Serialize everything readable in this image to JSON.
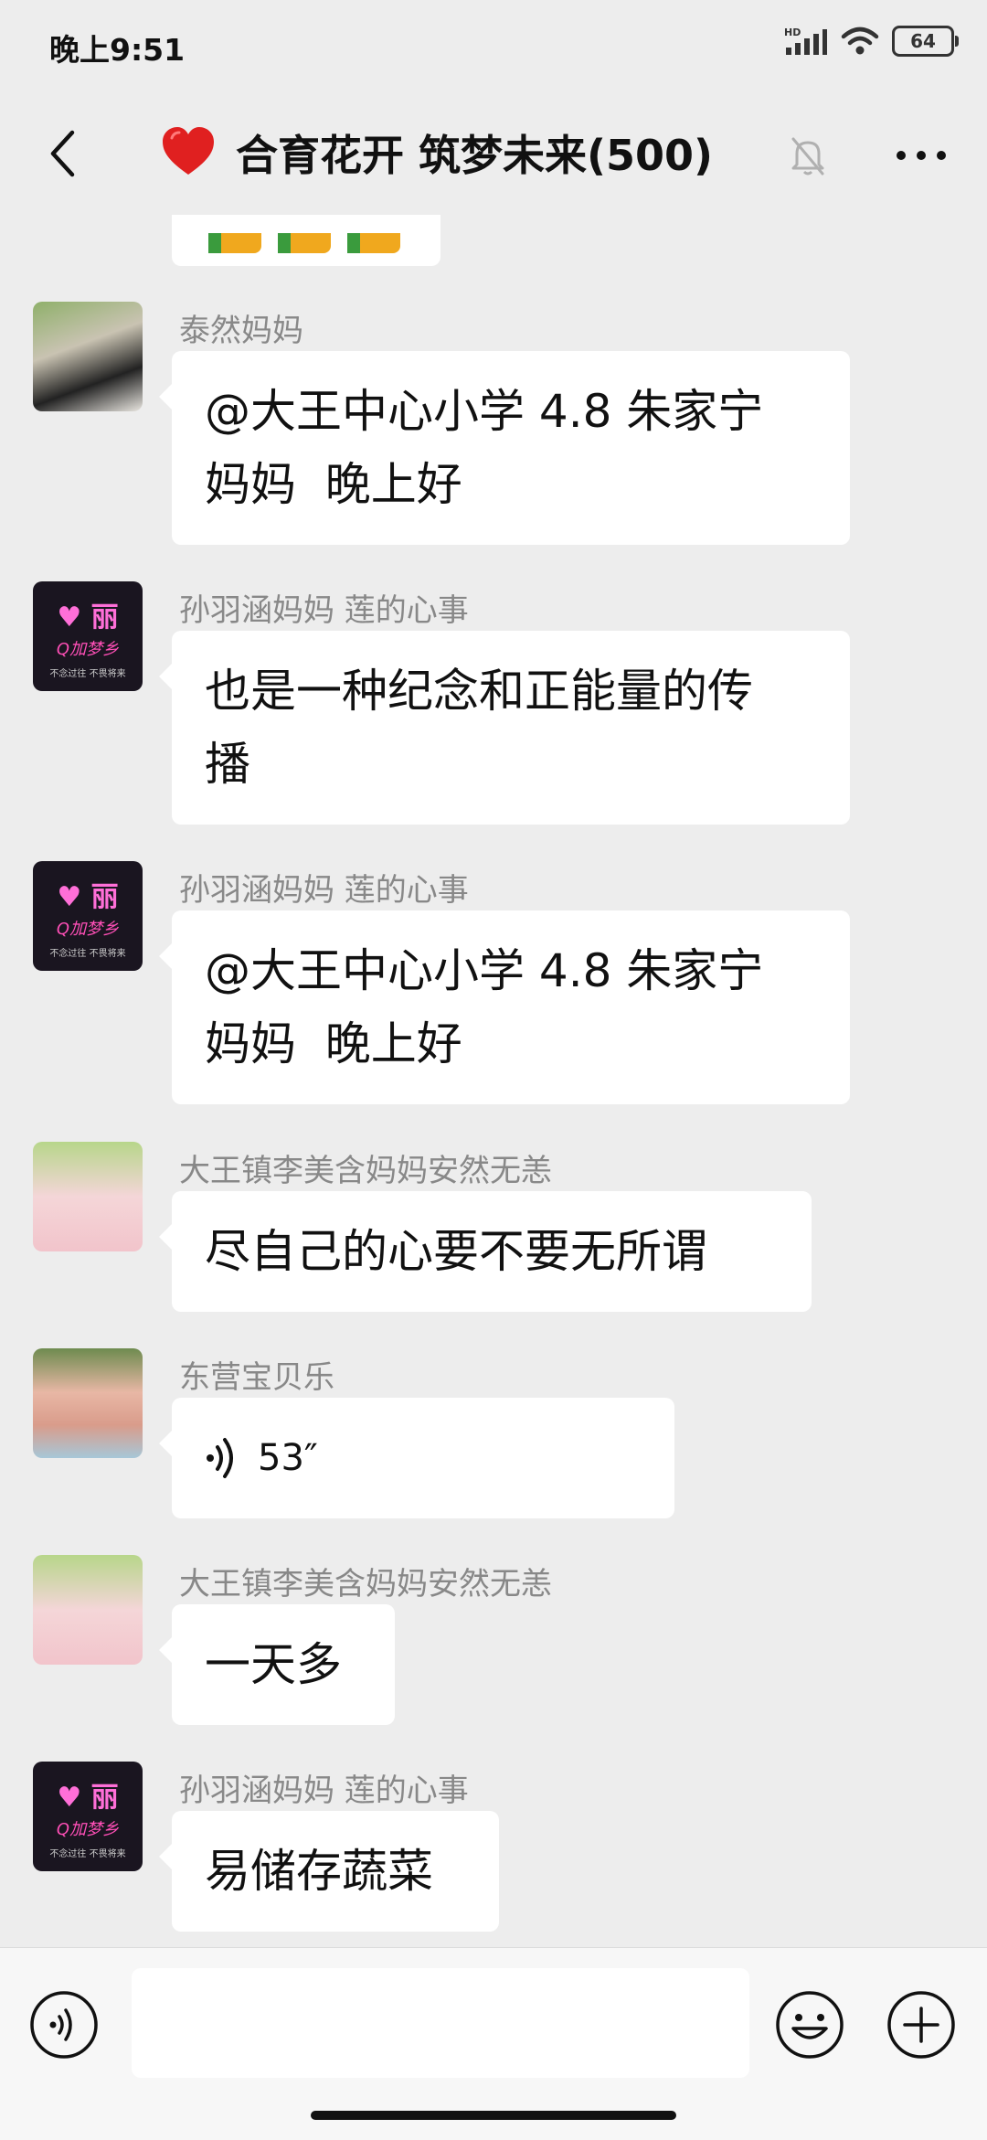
{
  "status_bar": {
    "time": "晚上9:51",
    "network": "HD",
    "battery": "64"
  },
  "header": {
    "title": "合育花开 筑梦未来(500)",
    "title_icon": "red-heart-emoji",
    "muted": true
  },
  "messages": [
    {
      "sender": "泰然妈妈",
      "text": "@大王中心小学 4.8 朱家宁\n妈妈  晚上好",
      "avatar": "woman-portrait"
    },
    {
      "sender": "孙羽涵妈妈  莲的心事",
      "text": "也是一种纪念和正能量的传\n播",
      "avatar": "pink-neon"
    },
    {
      "sender": "孙羽涵妈妈  莲的心事",
      "text": "@大王中心小学 4.8 朱家宁\n妈妈  晚上好",
      "avatar": "pink-neon"
    },
    {
      "sender": "大王镇李美含妈妈安然无恙",
      "text": "尽自己的心要不要无所谓",
      "avatar": "girl-photo"
    },
    {
      "sender": "东营宝贝乐",
      "voice_duration": "53″",
      "avatar": "lady-photo"
    },
    {
      "sender": "大王镇李美含妈妈安然无恙",
      "text": "一天多",
      "avatar": "girl-photo"
    },
    {
      "sender": "孙羽涵妈妈  莲的心事",
      "text": "易储存蔬菜",
      "avatar": "pink-neon"
    }
  ],
  "avatar_text": {
    "top": "♥ 丽",
    "middle": "Q加梦乡",
    "bottom": "不念过往  不畏将来"
  },
  "input": {
    "placeholder": ""
  },
  "colors": {
    "background": "#ededed",
    "bubble": "#ffffff",
    "sender_name": "#888888",
    "accent_red": "#e02020"
  }
}
